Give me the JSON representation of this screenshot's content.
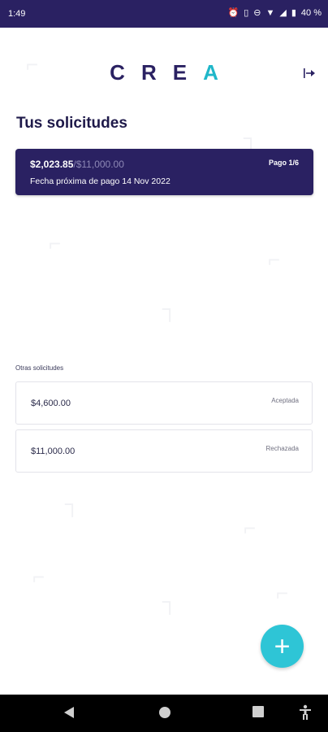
{
  "status_bar": {
    "time": "1:49",
    "battery": "40 %",
    "icons": [
      "alarm-icon",
      "vibrate-icon",
      "dnd-icon",
      "wifi-icon",
      "signal-icon",
      "battery-icon"
    ]
  },
  "header": {
    "logo": "CREA",
    "logout_icon": "logout-icon"
  },
  "main": {
    "title": "Tus solicitudes",
    "active_request": {
      "paid": "$2,023.85",
      "total": "/$11,000.00",
      "payment": "Pago 1/6",
      "next_date": "Fecha próxima de pago 14 Nov 2022"
    },
    "other_label": "Otras solicitudes",
    "other_requests": [
      {
        "amount": "$4,600.00",
        "status": "Aceptada"
      },
      {
        "amount": "$11,000.00",
        "status": "Rechazada"
      }
    ]
  },
  "fab": {
    "label": "+"
  },
  "colors": {
    "primary": "#2a2162",
    "accent": "#2ec5d6"
  }
}
